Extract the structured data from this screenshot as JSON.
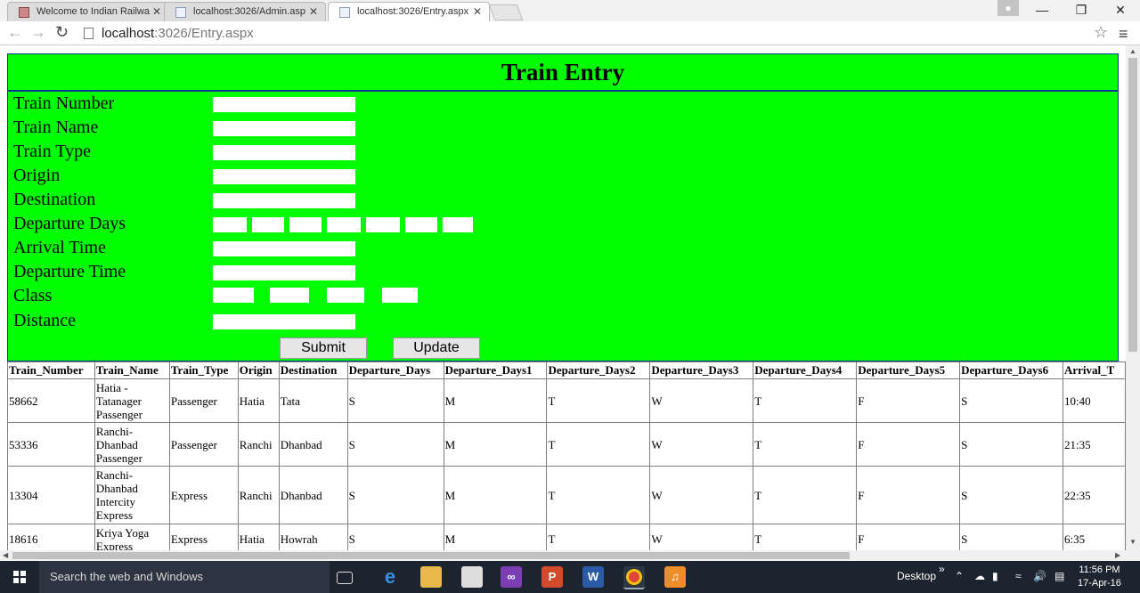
{
  "browser": {
    "tabs": [
      {
        "title": "Welcome to Indian Railwa"
      },
      {
        "title": "localhost:3026/Admin.asp"
      },
      {
        "title": "localhost:3026/Entry.aspx"
      }
    ],
    "close_glyph": "✕",
    "url_host": "localhost",
    "url_path": ":3026/Entry.aspx"
  },
  "form": {
    "title": "Train Entry",
    "labels": {
      "train_number": "Train Number",
      "train_name": "Train Name",
      "train_type": "Train Type",
      "origin": "Origin",
      "destination": "Destination",
      "departure_days": "Departure Days",
      "arrival_time": "Arrival Time",
      "departure_time": "Departure Time",
      "class": "Class",
      "distance": "Distance"
    },
    "values": {
      "train_number": "",
      "train_name": "",
      "train_type": "",
      "origin": "",
      "destination": "",
      "departure_days": [
        "",
        "",
        "",
        "",
        "",
        "",
        ""
      ],
      "arrival_time": "",
      "departure_time": "",
      "class": [
        "",
        "",
        "",
        ""
      ],
      "distance": ""
    },
    "submit_label": "Submit",
    "update_label": "Update"
  },
  "grid": {
    "headers": [
      "Train_Number",
      "Train_Name",
      "Train_Type",
      "Origin",
      "Destination",
      "Departure_Days",
      "Departure_Days1",
      "Departure_Days2",
      "Departure_Days3",
      "Departure_Days4",
      "Departure_Days5",
      "Departure_Days6",
      "Arrival_T"
    ],
    "rows": [
      [
        "58662",
        "Hatia - Tatanager Passenger",
        "Passenger",
        "Hatia",
        "Tata",
        "S",
        "M",
        "T",
        "W",
        "T",
        "F",
        "S",
        "10:40"
      ],
      [
        "53336",
        "Ranchi-Dhanbad Passenger",
        "Passenger",
        "Ranchi",
        "Dhanbad",
        "S",
        "M",
        "T",
        "W",
        "T",
        "F",
        "S",
        "21:35"
      ],
      [
        "13304",
        "Ranchi-Dhanbad Intercity Express",
        "Express",
        "Ranchi",
        "Dhanbad",
        "S",
        "M",
        "T",
        "W",
        "T",
        "F",
        "S",
        "22:35"
      ],
      [
        "18616",
        "Kriya Yoga Express",
        "Express",
        "Hatia",
        "Howrah",
        "S",
        "M",
        "T",
        "W",
        "T",
        "F",
        "S",
        "6:35"
      ]
    ]
  },
  "taskbar": {
    "search_placeholder": "Search the web and Windows",
    "desktop_label": "Desktop",
    "chevron": "»",
    "time": "11:56 PM",
    "date": "17-Apr-16",
    "icons": [
      "task-view",
      "edge",
      "file-explorer",
      "store",
      "visual-studio",
      "powerpoint",
      "word",
      "chrome",
      "uc-browser"
    ]
  }
}
